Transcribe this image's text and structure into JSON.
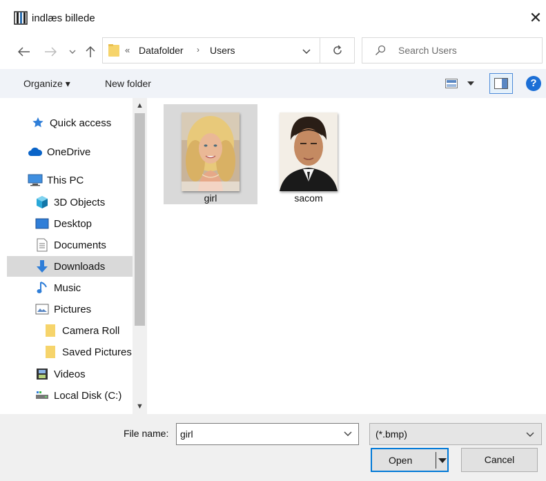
{
  "window": {
    "title": "indlæs billede",
    "close_glyph": "✕"
  },
  "nav": {
    "back_icon": "back-arrow-icon",
    "forward_icon": "forward-arrow-icon",
    "recent_icon": "chevron-down-icon",
    "up_icon": "up-arrow-icon",
    "address": {
      "overflow": "«",
      "crumbs": [
        "Datafolder",
        "Users"
      ],
      "separator": "›"
    },
    "search_placeholder": "Search Users"
  },
  "toolbar": {
    "organize_label": "Organize ▾",
    "new_folder_label": "New folder",
    "help_label": "?"
  },
  "sidebar": {
    "items": [
      {
        "label": "Quick access",
        "icon": "star-icon"
      },
      {
        "label": "OneDrive",
        "icon": "cloud-icon"
      },
      {
        "label": "This PC",
        "icon": "computer-icon"
      },
      {
        "label": "3D Objects",
        "icon": "cube-icon"
      },
      {
        "label": "Desktop",
        "icon": "desktop-icon"
      },
      {
        "label": "Documents",
        "icon": "document-icon"
      },
      {
        "label": "Downloads",
        "icon": "download-arrow-icon",
        "selected": true
      },
      {
        "label": "Music",
        "icon": "music-note-icon"
      },
      {
        "label": "Pictures",
        "icon": "pictures-icon"
      },
      {
        "label": "Camera Roll",
        "icon": "folder-icon"
      },
      {
        "label": "Saved Pictures",
        "icon": "folder-icon"
      },
      {
        "label": "Videos",
        "icon": "film-icon"
      },
      {
        "label": "Local Disk (C:)",
        "icon": "disk-icon"
      }
    ]
  },
  "files": [
    {
      "name": "girl",
      "selected": true
    },
    {
      "name": "sacom",
      "selected": false
    }
  ],
  "footer": {
    "file_name_label": "File name:",
    "file_name_value": "girl",
    "file_type_value": "(*.bmp)",
    "open_label": "Open",
    "cancel_label": "Cancel"
  },
  "colors": {
    "accent": "#0078d7",
    "toolbar_bg": "#f0f3f8",
    "selection": "#d9d9d9",
    "folder": "#f6d46b"
  }
}
